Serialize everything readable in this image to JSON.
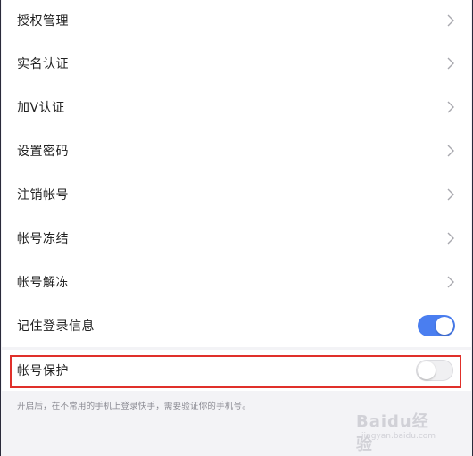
{
  "settings": {
    "items": [
      {
        "label": "授权管理"
      },
      {
        "label": "实名认证"
      },
      {
        "label": "加V认证"
      },
      {
        "label": "设置密码"
      },
      {
        "label": "注销帐号"
      },
      {
        "label": "帐号冻结"
      },
      {
        "label": "帐号解冻"
      }
    ],
    "remember_login": {
      "label": "记住登录信息",
      "enabled": true
    },
    "account_protect": {
      "label": "帐号保护",
      "enabled": false
    },
    "hint": "开启后，在不常用的手机上登录快手，需要验证你的手机号。"
  },
  "watermark": {
    "text": "Baidu经验",
    "sub": "jingyan.baidu.com"
  },
  "colors": {
    "toggle_on": "#4a7ef0",
    "highlight": "#e0302a"
  }
}
